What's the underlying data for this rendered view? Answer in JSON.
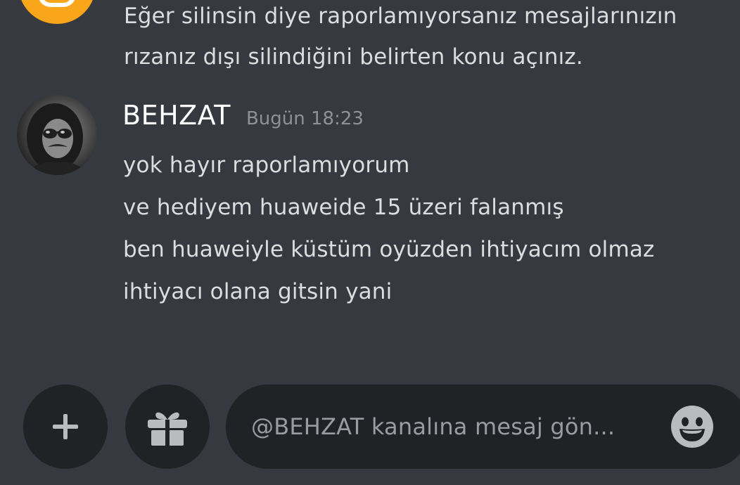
{
  "previous_message": {
    "lines": [
      "Eğer silinsin diye raporlamıyorsanız mesajlarınızın",
      "rızanız dışı silindiğini belirten konu açınız."
    ]
  },
  "message": {
    "username": "BEHZAT",
    "timestamp": "Bugün 18:23",
    "lines": [
      "yok hayır raporlamıyorum",
      "ve hediyem huaweide 15 üzeri falanmış",
      "ben huaweiyle küstüm oyüzden ihtiyacım olmaz",
      "ihtiyacı olana gitsin yani"
    ]
  },
  "composer": {
    "placeholder": "@BEHZAT kanalına mesaj gön...",
    "buttons": {
      "add_icon": "plus-icon",
      "gift_icon": "gift-icon",
      "emoji_icon": "emoji-icon"
    }
  },
  "colors": {
    "background": "#36393f",
    "input_background": "#202225",
    "text": "#dcddde",
    "username": "#ffffff",
    "timestamp": "#8e9297",
    "bot_avatar": "#faa61a"
  }
}
